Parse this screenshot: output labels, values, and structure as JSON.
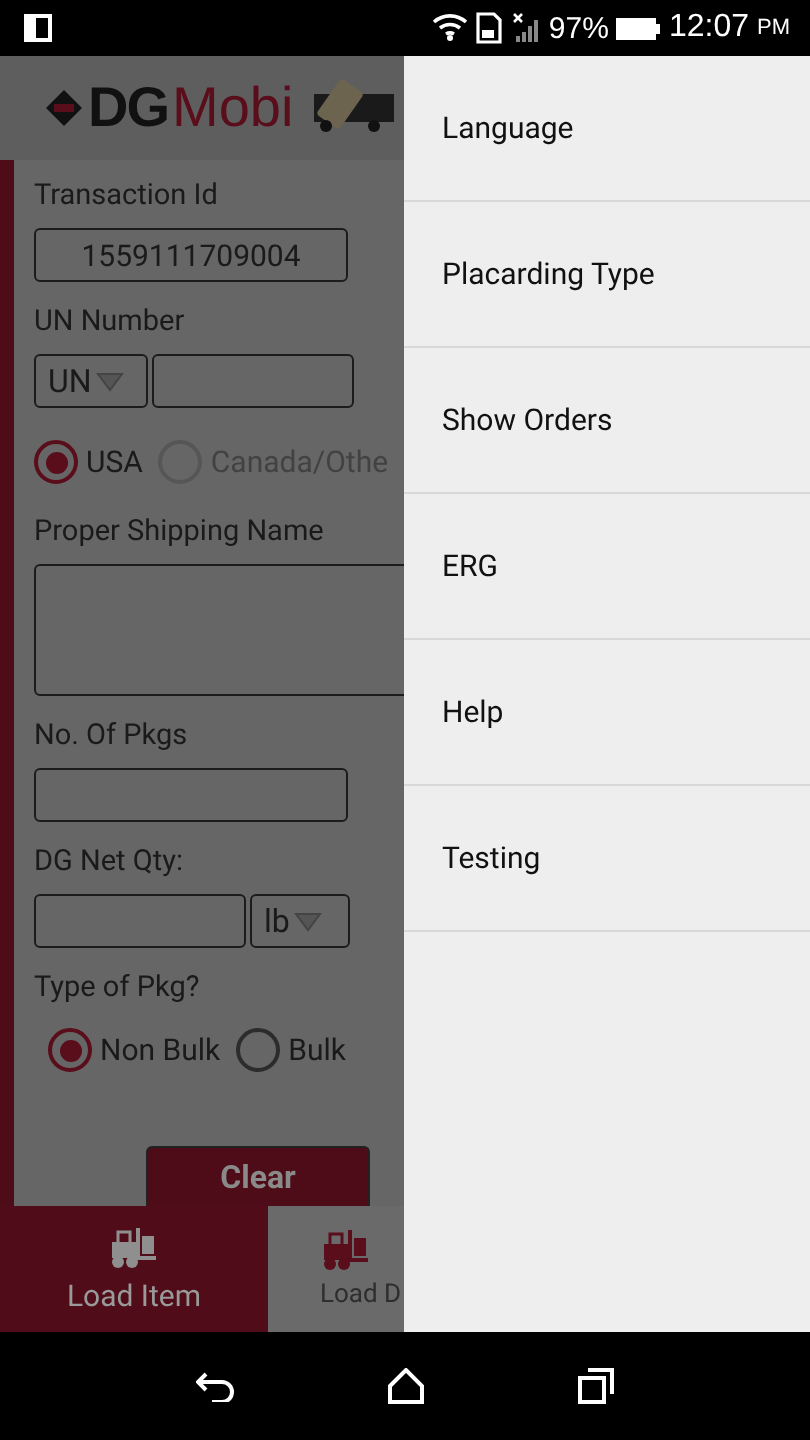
{
  "status_bar": {
    "battery": "97%",
    "time": "12:07",
    "meridiem": "PM"
  },
  "app": {
    "logo": {
      "part_1": "DG",
      "part_2": "Mobi"
    },
    "transaction": {
      "label": "Transaction Id",
      "value": "1559111709004"
    },
    "un_number": {
      "label": "UN Number",
      "prefix": "UN"
    },
    "country_options": [
      {
        "label": "USA",
        "selected": true,
        "disabled": false
      },
      {
        "label": "Canada/Othe",
        "selected": false,
        "disabled": true
      }
    ],
    "shipping_name": {
      "label": "Proper Shipping Name"
    },
    "packages": {
      "label": "No. Of Pkgs"
    },
    "net_qty": {
      "label": "DG Net Qty:",
      "unit": "lb"
    },
    "package_type": {
      "label": "Type of Pkg?",
      "options": [
        {
          "label": "Non Bulk",
          "selected": true,
          "disabled": false
        },
        {
          "label": "Bulk",
          "selected": false,
          "disabled": false
        }
      ]
    },
    "clear_button": "Clear",
    "tabs": [
      {
        "label": "Load Item",
        "selected": true
      },
      {
        "label": "Load D",
        "selected": false
      }
    ]
  },
  "drawer": {
    "items": [
      "Language",
      "Placarding Type",
      "Show Orders",
      "ERG",
      "Help",
      "Testing"
    ]
  }
}
